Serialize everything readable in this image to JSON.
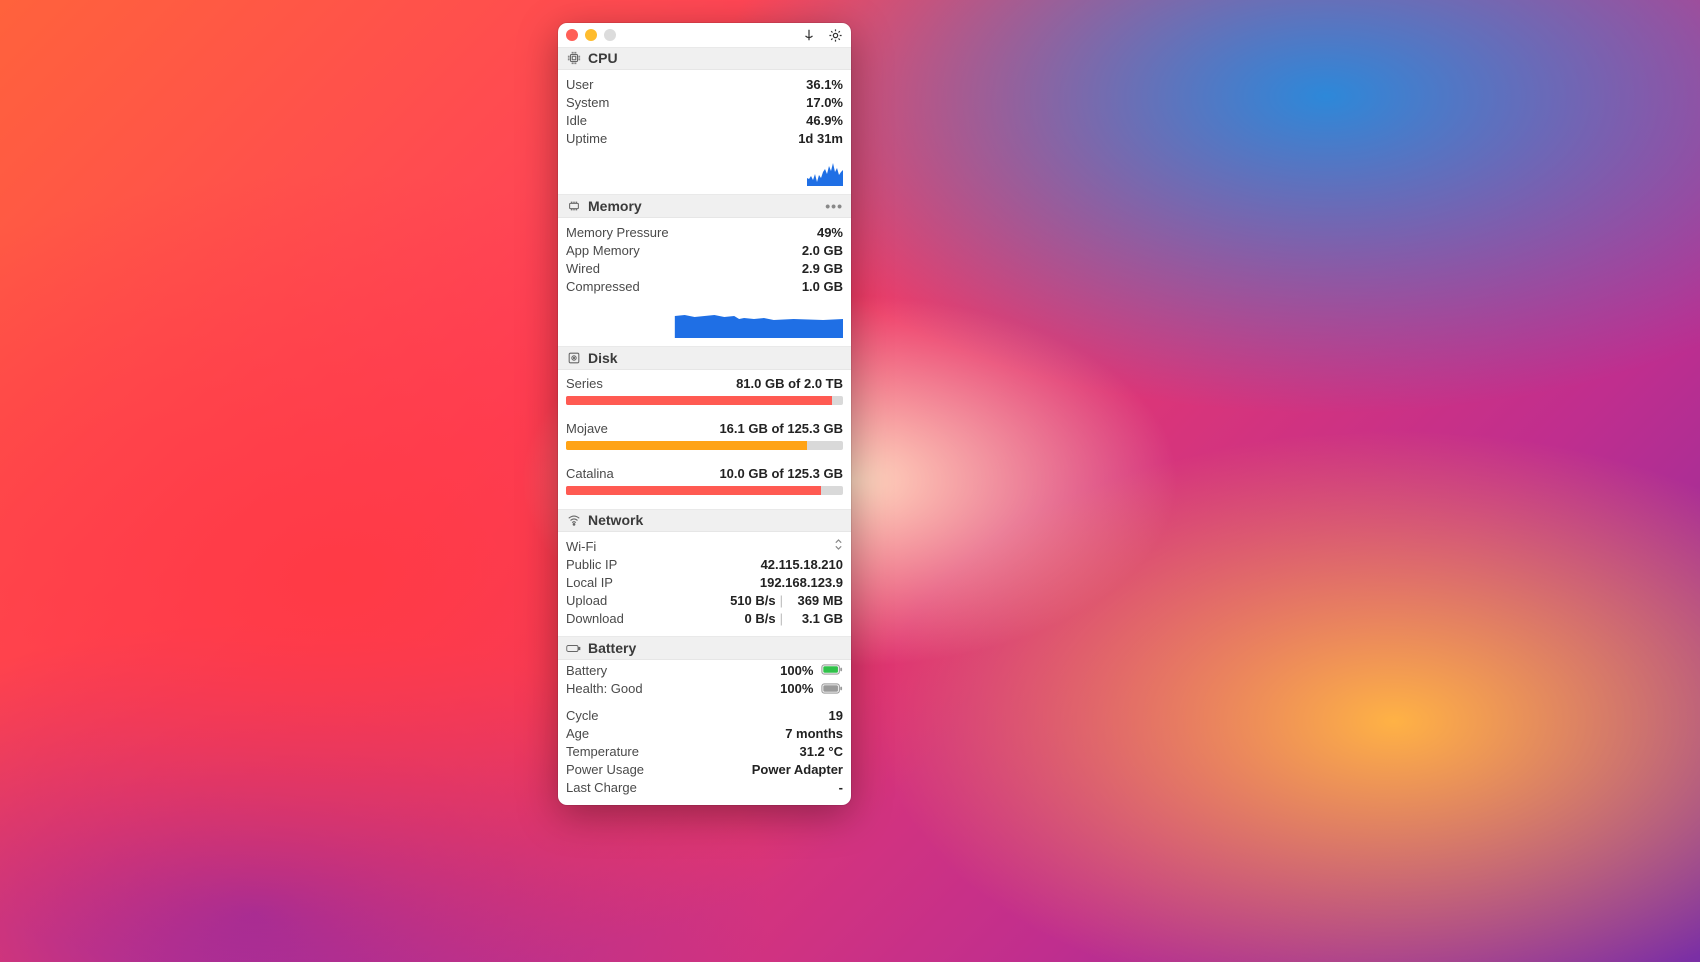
{
  "cpu": {
    "title": "CPU",
    "rows": {
      "user": {
        "label": "User",
        "value": "36.1%"
      },
      "system": {
        "label": "System",
        "value": "17.0%"
      },
      "idle": {
        "label": "Idle",
        "value": "46.9%"
      },
      "uptime": {
        "label": "Uptime",
        "value": "1d 31m"
      }
    }
  },
  "memory": {
    "title": "Memory",
    "rows": {
      "pressure": {
        "label": "Memory Pressure",
        "value": "49%"
      },
      "app": {
        "label": "App Memory",
        "value": "2.0 GB"
      },
      "wired": {
        "label": "Wired",
        "value": "2.9 GB"
      },
      "compressed": {
        "label": "Compressed",
        "value": "1.0 GB"
      }
    }
  },
  "disk": {
    "title": "Disk",
    "volumes": {
      "v0": {
        "name": "Series",
        "value": "81.0 GB of 2.0 TB",
        "fill_pct": 96,
        "color": "red"
      },
      "v1": {
        "name": "Mojave",
        "value": "16.1 GB of 125.3 GB",
        "fill_pct": 87,
        "color": "orange"
      },
      "v2": {
        "name": "Catalina",
        "value": "10.0 GB of 125.3 GB",
        "fill_pct": 92,
        "color": "red"
      }
    }
  },
  "network": {
    "title": "Network",
    "interface": "Wi-Fi",
    "public_ip": {
      "label": "Public IP",
      "value": "42.115.18.210"
    },
    "local_ip": {
      "label": "Local IP",
      "value": "192.168.123.9"
    },
    "upload": {
      "label": "Upload",
      "rate": "510 B/s",
      "total": "369 MB"
    },
    "download": {
      "label": "Download",
      "rate": "0 B/s",
      "total": "3.1 GB"
    }
  },
  "battery": {
    "title": "Battery",
    "charge": {
      "label": "Battery",
      "value": "100%"
    },
    "health": {
      "label": "Health: Good",
      "value": "100%"
    },
    "cycle": {
      "label": "Cycle",
      "value": "19"
    },
    "age": {
      "label": "Age",
      "value": "7 months"
    },
    "temperature": {
      "label": "Temperature",
      "value": "31.2 °C"
    },
    "power": {
      "label": "Power Usage",
      "value": "Power Adapter"
    },
    "last_charge": {
      "label": "Last Charge",
      "value": "-"
    }
  },
  "colors": {
    "blue": "#1f6fe5",
    "green": "#30c24a",
    "grey": "#bcbcbc"
  }
}
